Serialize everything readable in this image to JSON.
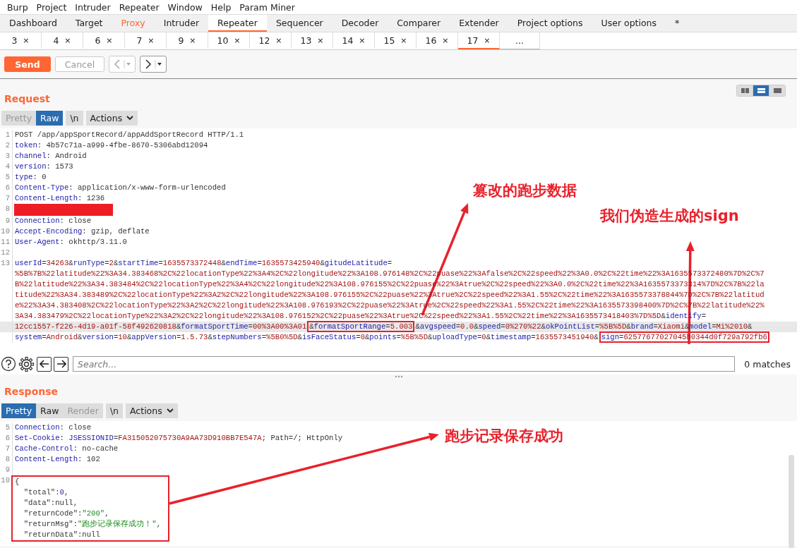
{
  "menu": [
    "Burp",
    "Project",
    "Intruder",
    "Repeater",
    "Window",
    "Help",
    "Param Miner"
  ],
  "main_tabs": [
    {
      "label": "Dashboard",
      "selected": false,
      "highlighted": false
    },
    {
      "label": "Target",
      "selected": false,
      "highlighted": false
    },
    {
      "label": "Proxy",
      "selected": false,
      "highlighted": true
    },
    {
      "label": "Intruder",
      "selected": false,
      "highlighted": false
    },
    {
      "label": "Repeater",
      "selected": true,
      "highlighted": false
    },
    {
      "label": "Sequencer",
      "selected": false,
      "highlighted": false
    },
    {
      "label": "Decoder",
      "selected": false,
      "highlighted": false
    },
    {
      "label": "Comparer",
      "selected": false,
      "highlighted": false
    },
    {
      "label": "Extender",
      "selected": false,
      "highlighted": false
    },
    {
      "label": "Project options",
      "selected": false,
      "highlighted": false
    },
    {
      "label": "User options",
      "selected": false,
      "highlighted": false
    },
    {
      "label": "*",
      "selected": false,
      "highlighted": false
    }
  ],
  "repeater_tabs": [
    {
      "label": "3",
      "close": "×",
      "selected": false
    },
    {
      "label": "4",
      "close": "×",
      "selected": false
    },
    {
      "label": "6",
      "close": "×",
      "selected": false
    },
    {
      "label": "7",
      "close": "×",
      "selected": false
    },
    {
      "label": "9",
      "close": "×",
      "selected": false
    },
    {
      "label": "10",
      "close": "×",
      "selected": false
    },
    {
      "label": "12",
      "close": "×",
      "selected": false
    },
    {
      "label": "13",
      "close": "×",
      "selected": false
    },
    {
      "label": "14",
      "close": "×",
      "selected": false
    },
    {
      "label": "15",
      "close": "×",
      "selected": false
    },
    {
      "label": "16",
      "close": "×",
      "selected": false
    },
    {
      "label": "17",
      "close": "×",
      "selected": true
    },
    {
      "label": "..."
    }
  ],
  "toolbar": {
    "send": "Send",
    "cancel": {
      "label": "Cancel",
      "disabled": true
    },
    "back": {
      "disabled": true
    },
    "forward": {
      "disabled": false
    }
  },
  "view_modes": [
    {
      "kind": "side_by_side",
      "selected": false
    },
    {
      "kind": "stacked",
      "selected": true
    },
    {
      "kind": "single",
      "selected": false
    }
  ],
  "request": {
    "title": "Request",
    "view_tabs": [
      {
        "label": "Pretty",
        "selected": false,
        "disabled": true
      },
      {
        "label": "Raw",
        "selected": true,
        "disabled": false
      }
    ],
    "newline_button": "\\n",
    "actions_button": "Actions",
    "lines": [
      {
        "n": "1",
        "kind": "text",
        "segments": [
          {
            "text": "POST /app/appSportRecord/appAddSportRecord HTTP/1.1",
            "kind": "plain"
          }
        ]
      },
      {
        "n": "2",
        "kind": "text",
        "segments": [
          {
            "text": "token",
            "kind": "key"
          },
          {
            "text": ": 4b57c71a-a999-4fbe-8670-5306abd12094",
            "kind": "plain"
          }
        ]
      },
      {
        "n": "3",
        "kind": "text",
        "segments": [
          {
            "text": "channel",
            "kind": "key"
          },
          {
            "text": ": Android",
            "kind": "plain"
          }
        ]
      },
      {
        "n": "4",
        "kind": "text",
        "segments": [
          {
            "text": "version",
            "kind": "key"
          },
          {
            "text": ": 1573",
            "kind": "plain"
          }
        ]
      },
      {
        "n": "5",
        "kind": "text",
        "segments": [
          {
            "text": "type",
            "kind": "key"
          },
          {
            "text": ": 0",
            "kind": "plain"
          }
        ]
      },
      {
        "n": "6",
        "kind": "text",
        "segments": [
          {
            "text": "Content-Type",
            "kind": "key"
          },
          {
            "text": ": application/x-www-form-urlencoded",
            "kind": "plain"
          }
        ]
      },
      {
        "n": "7",
        "kind": "text",
        "segments": [
          {
            "text": "Content-Length",
            "kind": "key"
          },
          {
            "text": ": 1236",
            "kind": "plain"
          }
        ]
      },
      {
        "n": "8",
        "kind": "redacted"
      },
      {
        "n": "9",
        "kind": "text",
        "segments": [
          {
            "text": "Connection",
            "kind": "key"
          },
          {
            "text": ": close",
            "kind": "plain"
          }
        ]
      },
      {
        "n": "10",
        "kind": "text",
        "segments": [
          {
            "text": "Accept-Encoding",
            "kind": "key"
          },
          {
            "text": ": gzip, deflate",
            "kind": "plain"
          }
        ]
      },
      {
        "n": "11",
        "kind": "text",
        "segments": [
          {
            "text": "User-Agent",
            "kind": "key"
          },
          {
            "text": ": okhttp/3.11.0",
            "kind": "plain"
          }
        ]
      },
      {
        "n": "12",
        "kind": "blank"
      },
      {
        "n": "13",
        "kind": "query",
        "rows": [
          {
            "highlighted": false,
            "parts": [
              {
                "text": "userId=34263&runType=2&startTime=1635573372448&endTime=1635573425940&gitudeLatitude=",
                "boxed": false
              }
            ]
          },
          {
            "highlighted": false,
            "parts": [
              {
                "text": "%5B%7B%22latitude%22%3A34.383468%2C%22locationType%22%3A4%2C%22longitude%22%3A108.976148%2C%22puase%22%3Afalse%2C%22speed%22%3A0.0%2C%22time%22%3A1635573372480%7D%2C%7",
                "boxed": false
              }
            ]
          },
          {
            "highlighted": false,
            "parts": [
              {
                "text": "B%22latitude%22%3A34.383484%2C%22locationType%22%3A4%2C%22longitude%22%3A108.976155%2C%22puase%22%3Atrue%2C%22speed%22%3A0.0%2C%22time%22%3A1635573373314%7D%2C%7B%22la",
                "boxed": false
              }
            ]
          },
          {
            "highlighted": false,
            "parts": [
              {
                "text": "titude%22%3A34.383489%2C%22locationType%22%3A2%2C%22longitude%22%3A108.976155%2C%22puase%22%3Atrue%2C%22speed%22%3A1.55%2C%22time%22%3A1635573378844%7D%2C%7B%22latitud",
                "boxed": false
              }
            ]
          },
          {
            "highlighted": false,
            "parts": [
              {
                "text": "e%22%3A34.383408%2C%22locationType%22%3A2%2C%22longitude%22%3A108.976193%2C%22puase%22%3Atrue%2C%22speed%22%3A1.55%2C%22time%22%3A1635573398400%7D%2C%7B%22latitude%22%",
                "boxed": false
              }
            ]
          },
          {
            "highlighted": false,
            "parts": [
              {
                "text": "3A34.383479%2C%22locationType%22%3A2%2C%22longitude%22%3A108.976152%2C%22puase%22%3Atrue%2C%22speed%22%3A1.55%2C%22time%22%3A1635573418403%7D%5D&identify=",
                "boxed": false
              }
            ]
          },
          {
            "highlighted": true,
            "parts": [
              {
                "text": "12cc1557-f226-4d19-a01f-58f492620818&formatSportTime=00%3A00%3A01",
                "boxed": false
              },
              {
                "text": "&formatSportRange=5.003",
                "boxed": true
              },
              {
                "text": "&avgspeed=0.0&speed=0%270%22&okPointList=%5B%5D&brand=Xiaomi&model=Mi%2010&",
                "boxed": false
              }
            ]
          },
          {
            "highlighted": false,
            "parts": [
              {
                "text": "system=Android&version=10&appVersion=1.5.73&stepNumbers=%5B0%5D&isFaceStatus=0&points=%5B%5D&uploadType=0&timestamp=1635573451940&",
                "boxed": false
              },
              {
                "text": "sign=62577677027045b0344d0f729a792fb6",
                "boxed": true
              }
            ]
          }
        ]
      }
    ]
  },
  "search": {
    "placeholder": "Search...",
    "matches": "0 matches"
  },
  "response": {
    "title": "Response",
    "view_tabs": [
      {
        "label": "Pretty",
        "selected": true,
        "disabled": false
      },
      {
        "label": "Raw",
        "selected": false,
        "disabled": false
      },
      {
        "label": "Render",
        "selected": false,
        "disabled": true
      }
    ],
    "newline_button": "\\n",
    "actions_button": "Actions",
    "lines": [
      {
        "n": "5",
        "kind": "text",
        "boxed": false,
        "segments": [
          {
            "text": "Connection",
            "kind": "key"
          },
          {
            "text": ": close",
            "kind": "plain"
          }
        ]
      },
      {
        "n": "6",
        "kind": "text",
        "boxed": false,
        "segments": [
          {
            "text": "Set-Cookie",
            "kind": "key"
          },
          {
            "text": ": ",
            "kind": "plain"
          },
          {
            "text": "JSESSIONID",
            "kind": "key"
          },
          {
            "text": "=",
            "kind": "plain"
          },
          {
            "text": "FA315052075730A9AA73D910BB7E547A",
            "kind": "value"
          },
          {
            "text": "; Path=/; HttpOnly",
            "kind": "plain"
          }
        ]
      },
      {
        "n": "7",
        "kind": "text",
        "boxed": false,
        "segments": [
          {
            "text": "Cache-Control",
            "kind": "key"
          },
          {
            "text": ": no-cache",
            "kind": "plain"
          }
        ]
      },
      {
        "n": "8",
        "kind": "text",
        "boxed": false,
        "segments": [
          {
            "text": "Content-Length",
            "kind": "key"
          },
          {
            "text": ": 102",
            "kind": "plain"
          }
        ]
      },
      {
        "n": "9",
        "kind": "blank",
        "boxed": false
      },
      {
        "n": "10",
        "kind": "text",
        "boxed": true,
        "segments": [
          {
            "text": "{",
            "kind": "plain"
          }
        ]
      },
      {
        "kind": "text",
        "boxed": true,
        "segments": [
          {
            "text": "  \"total\"",
            "kind": "plain"
          },
          {
            "text": ":",
            "kind": "plain"
          },
          {
            "text": "0",
            "kind": "number"
          },
          {
            "text": ",",
            "kind": "plain"
          }
        ]
      },
      {
        "kind": "text",
        "boxed": true,
        "segments": [
          {
            "text": "  \"data\"",
            "kind": "plain"
          },
          {
            "text": ":null,",
            "kind": "plain"
          }
        ]
      },
      {
        "kind": "text",
        "boxed": true,
        "segments": [
          {
            "text": "  \"returnCode\"",
            "kind": "plain"
          },
          {
            "text": ":",
            "kind": "plain"
          },
          {
            "text": "\"200\"",
            "kind": "string"
          },
          {
            "text": ",",
            "kind": "plain"
          }
        ]
      },
      {
        "kind": "text",
        "boxed": true,
        "segments": [
          {
            "text": "  \"returnMsg\"",
            "kind": "plain"
          },
          {
            "text": ":",
            "kind": "plain"
          },
          {
            "text": "\"跑步记录保存成功！\"",
            "kind": "string"
          },
          {
            "text": ",",
            "kind": "plain"
          }
        ]
      },
      {
        "kind": "text",
        "boxed": true,
        "segments": [
          {
            "text": "  \"returnData\"",
            "kind": "plain"
          },
          {
            "text": ":null",
            "kind": "plain"
          }
        ]
      }
    ]
  },
  "annotations": [
    {
      "text": "篡改的跑步数据"
    },
    {
      "text": "我们伪造生成的sign"
    },
    {
      "text": "跑步记录保存成功"
    }
  ]
}
